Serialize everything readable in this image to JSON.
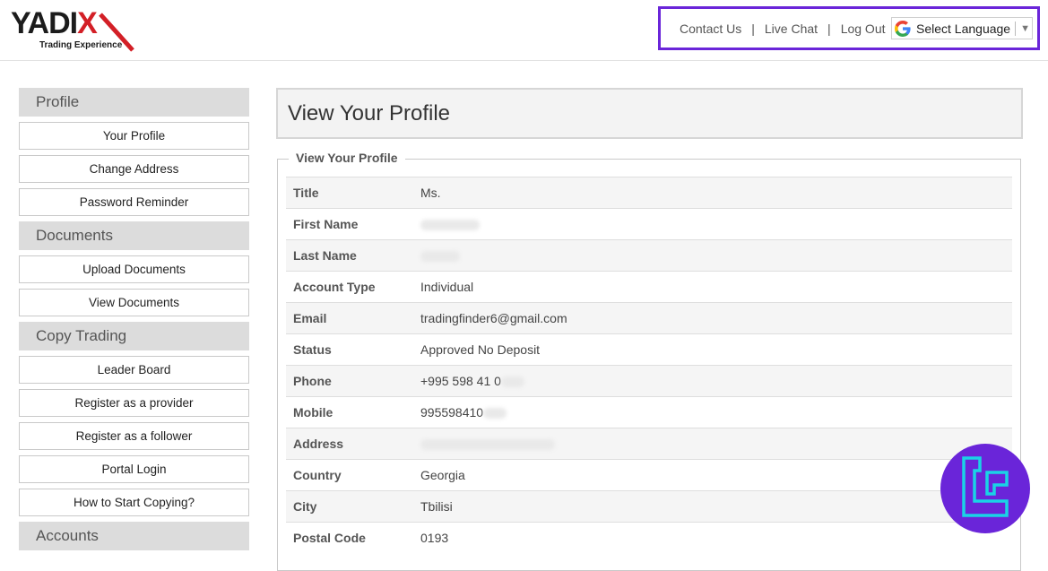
{
  "header": {
    "logo": {
      "brand_main": "YADI",
      "brand_x": "X",
      "tagline": "Trading Experience"
    },
    "nav": {
      "contact_us": "Contact Us",
      "live_chat": "Live Chat",
      "log_out": "Log Out",
      "separator": "|",
      "language_select": "Select Language"
    }
  },
  "sidebar": {
    "sections": [
      {
        "heading": "Profile",
        "items": [
          "Your Profile",
          "Change Address",
          "Password Reminder"
        ]
      },
      {
        "heading": "Documents",
        "items": [
          "Upload Documents",
          "View Documents"
        ]
      },
      {
        "heading": "Copy Trading",
        "items": [
          "Leader Board",
          "Register as a provider",
          "Register as a follower",
          "Portal Login",
          "How to Start Copying?"
        ]
      },
      {
        "heading": "Accounts",
        "items": []
      }
    ]
  },
  "main": {
    "page_title": "View Your Profile",
    "fieldset_legend": "View Your Profile",
    "rows": [
      {
        "label": "Title",
        "value": "Ms."
      },
      {
        "label": "First Name",
        "value": ""
      },
      {
        "label": "Last Name",
        "value": ""
      },
      {
        "label": "Account Type",
        "value": "Individual"
      },
      {
        "label": "Email",
        "value": "tradingfinder6@gmail.com"
      },
      {
        "label": "Status",
        "value": "Approved No Deposit"
      },
      {
        "label": "Phone",
        "value": "+995 598 41 0"
      },
      {
        "label": "Mobile",
        "value": "995598410"
      },
      {
        "label": "Address",
        "value": ""
      },
      {
        "label": "Country",
        "value": "Georgia"
      },
      {
        "label": "City",
        "value": "Tbilisi"
      },
      {
        "label": "Postal Code",
        "value": "0193"
      }
    ]
  },
  "colors": {
    "accent_border": "#6a25d9",
    "logo_red": "#d31f26",
    "badge_purple": "#6a25d9",
    "badge_cyan": "#19d3e6"
  }
}
